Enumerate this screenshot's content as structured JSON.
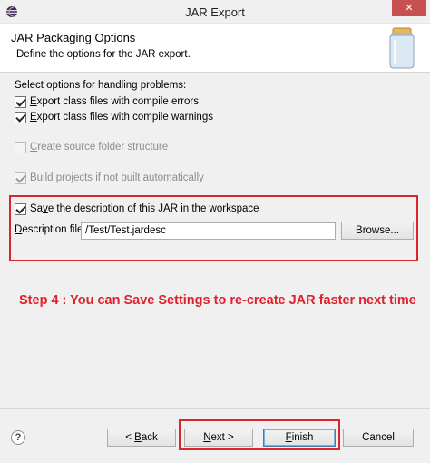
{
  "window": {
    "title": "JAR Export",
    "close_glyph": "✕"
  },
  "header": {
    "title": "JAR Packaging Options",
    "description": "Define the options for the JAR export."
  },
  "handling": {
    "heading": "Select options for handling problems:",
    "export_errors": {
      "mnemonic": "E",
      "rest": "xport class files with compile errors",
      "checked": true
    },
    "export_warnings": {
      "mnemonic": "E",
      "rest": "xport class files with compile warnings",
      "checked": true
    }
  },
  "create_source": {
    "mnemonic": "C",
    "rest": "reate source folder structure",
    "checked": false,
    "enabled": false
  },
  "build_projects": {
    "mnemonic": "B",
    "rest": "uild projects if not built automatically",
    "checked": true,
    "enabled": false
  },
  "save_description": {
    "prefix": "Sa",
    "mnemonic": "v",
    "rest": "e the description of this JAR in the workspace",
    "checked": true
  },
  "description_file": {
    "mnemonic": "D",
    "label_rest": "escription file:",
    "value": "/Test/Test.jardesc",
    "browse_label": "Browse..."
  },
  "annotation": "Step 4 : You can Save Settings to re-create JAR faster next time",
  "footer": {
    "help_glyph": "?",
    "back_label": "< Back",
    "next_label": "Next >",
    "finish_label": "Finish",
    "cancel_label": "Cancel"
  },
  "colors": {
    "highlight": "#d9252f",
    "annotation": "#e0202b"
  },
  "icons": {
    "window": "eclipse-window-icon",
    "header": "jar-icon",
    "help": "help-icon"
  }
}
